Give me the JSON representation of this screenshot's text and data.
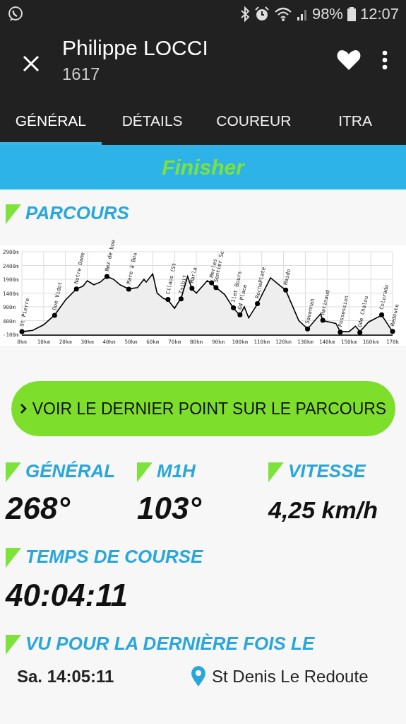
{
  "status_bar": {
    "battery": "98%",
    "time": "12:07"
  },
  "header": {
    "title": "Philippe LOCCI",
    "subtitle": "1617"
  },
  "tabs": [
    {
      "label": "GÉNÉRAL",
      "selected": true
    },
    {
      "label": "DÉTAILS",
      "selected": false
    },
    {
      "label": "COUREUR",
      "selected": false
    },
    {
      "label": "ITRA",
      "selected": false
    }
  ],
  "banner": "Finisher",
  "parcours": {
    "title": "PARCOURS",
    "chart_data": {
      "type": "line",
      "x": [
        0,
        5,
        10,
        15,
        20,
        25,
        28,
        30,
        33,
        36,
        39,
        42,
        45,
        49,
        53,
        56,
        57,
        60,
        62,
        65,
        67,
        70,
        72,
        73,
        76,
        78,
        80,
        85,
        87,
        89,
        93,
        97,
        100,
        102,
        104,
        108,
        114,
        121,
        127,
        131,
        137,
        138,
        144,
        146,
        150,
        153,
        155,
        159,
        165,
        170
      ],
      "series": [
        {
          "color": "#000000",
          "values": [
            0,
            50,
            250,
            600,
            1150,
            1550,
            1650,
            1850,
            1700,
            1800,
            2000,
            1900,
            1700,
            1550,
            1600,
            1900,
            1800,
            2100,
            1400,
            1200,
            1150,
            850,
            1100,
            1200,
            2000,
            1550,
            1400,
            1850,
            1750,
            1600,
            1350,
            850,
            600,
            900,
            500,
            1000,
            1950,
            1500,
            400,
            100,
            650,
            400,
            300,
            0,
            0,
            200,
            0,
            350,
            600,
            0
          ]
        }
      ],
      "grid": true,
      "xlim": [
        0,
        170
      ],
      "ylim": [
        -100,
        2900
      ],
      "xticks": [
        {
          "value": 0,
          "label": "0km"
        },
        {
          "value": 10,
          "label": "10km"
        },
        {
          "value": 20,
          "label": "20km"
        },
        {
          "value": 30,
          "label": "30km"
        },
        {
          "value": 40,
          "label": "40km"
        },
        {
          "value": 50,
          "label": "50km"
        },
        {
          "value": 60,
          "label": "60km"
        },
        {
          "value": 70,
          "label": "70km"
        },
        {
          "value": 80,
          "label": "80km"
        },
        {
          "value": 90,
          "label": "90km"
        },
        {
          "value": 100,
          "label": "100km"
        },
        {
          "value": 110,
          "label": "110km"
        },
        {
          "value": 120,
          "label": "120km"
        },
        {
          "value": 130,
          "label": "130km"
        },
        {
          "value": 140,
          "label": "140km"
        },
        {
          "value": 150,
          "label": "150km"
        },
        {
          "value": 160,
          "label": "160km"
        },
        {
          "value": 170,
          "label": "170k"
        }
      ],
      "yticks": [
        {
          "value": -100,
          "label": "-100m"
        },
        {
          "value": 400,
          "label": "400m"
        },
        {
          "value": 900,
          "label": "900m"
        },
        {
          "value": 1400,
          "label": "1400m"
        },
        {
          "value": 1900,
          "label": "1900m"
        },
        {
          "value": 2400,
          "label": "2400m"
        },
        {
          "value": 2900,
          "label": "2900m"
        }
      ],
      "annotations": [
        {
          "x": 0,
          "y": 0,
          "text": "St Pierre"
        },
        {
          "x": 15,
          "y": 590,
          "text": "Dom Vidot"
        },
        {
          "x": 25,
          "y": 1550,
          "text": "Notre Dame"
        },
        {
          "x": 39,
          "y": 2000,
          "text": "Nez de boe"
        },
        {
          "x": 49,
          "y": 1540,
          "text": "Mare à Bou"
        },
        {
          "x": 67,
          "y": 1170,
          "text": "Cilaos (St"
        },
        {
          "x": 73,
          "y": 1190,
          "text": "Taibit"
        },
        {
          "x": 78,
          "y": 1570,
          "text": "Marla"
        },
        {
          "x": 87,
          "y": 1770,
          "text": "Merles"
        },
        {
          "x": 89,
          "y": 1600,
          "text": "Sentier Sc"
        },
        {
          "x": 97,
          "y": 870,
          "text": "Ilet Bours"
        },
        {
          "x": 100,
          "y": 610,
          "text": "Gd Place"
        },
        {
          "x": 108,
          "y": 1015,
          "text": "RochePlate"
        },
        {
          "x": 121,
          "y": 1510,
          "text": "Maido"
        },
        {
          "x": 131,
          "y": 100,
          "text": "Savannah"
        },
        {
          "x": 138,
          "y": 410,
          "text": "Ratinaud"
        },
        {
          "x": 146,
          "y": -15,
          "text": "Possession"
        },
        {
          "x": 155,
          "y": -30,
          "text": "Gde Chalou"
        },
        {
          "x": 165,
          "y": 610,
          "text": "Colorado"
        },
        {
          "x": 170,
          "y": 10,
          "text": "Redoute"
        }
      ]
    }
  },
  "action_button": "VOIR LE DERNIER POINT SUR LE PARCOURS",
  "stats": [
    {
      "label": "GÉNÉRAL",
      "value": "268°"
    },
    {
      "label": "M1H",
      "value": "103°"
    },
    {
      "label": "VITESSE",
      "value": "4,25 km/h"
    }
  ],
  "race_time": {
    "label": "TEMPS DE COURSE",
    "value": "40:04:11"
  },
  "last_seen": {
    "title": "VU POUR LA DERNIÈRE FOIS LE",
    "time": "Sa. 14:05:11",
    "location": "St Denis Le Redoute"
  }
}
